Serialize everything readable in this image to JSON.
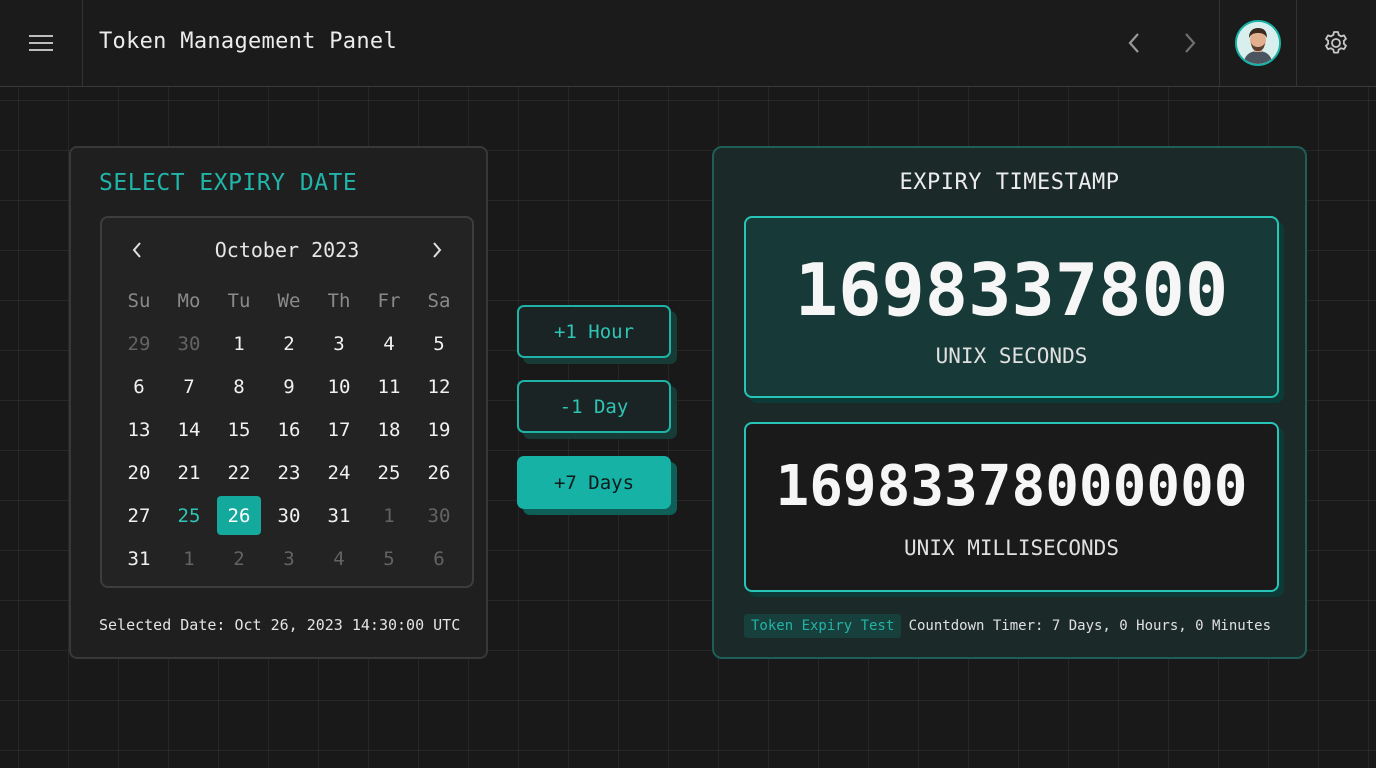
{
  "header": {
    "title": "Token Management Panel"
  },
  "icons": {
    "menu": "hamburger-menu-icon",
    "back": "chevron-left-icon",
    "forward": "chevron-right-icon",
    "settings": "gear-icon",
    "avatar": "user-avatar"
  },
  "colors": {
    "accent": "#1fb2a6",
    "background": "#191919",
    "panel": "#1f1f1f",
    "timestamp_panel": "#1b2a29"
  },
  "date_picker": {
    "title": "SELECT EXPIRY DATE",
    "month_label": "October 2023",
    "weekdays": [
      "Su",
      "Mo",
      "Tu",
      "We",
      "Th",
      "Fr",
      "Sa"
    ],
    "days": [
      {
        "label": "29",
        "other": true
      },
      {
        "label": "30",
        "other": true
      },
      {
        "label": "1"
      },
      {
        "label": "2"
      },
      {
        "label": "3"
      },
      {
        "label": "4"
      },
      {
        "label": "5"
      },
      {
        "label": "6"
      },
      {
        "label": "7"
      },
      {
        "label": "8"
      },
      {
        "label": "9"
      },
      {
        "label": "10"
      },
      {
        "label": "11"
      },
      {
        "label": "12"
      },
      {
        "label": "13"
      },
      {
        "label": "14"
      },
      {
        "label": "15"
      },
      {
        "label": "16"
      },
      {
        "label": "17"
      },
      {
        "label": "18"
      },
      {
        "label": "19"
      },
      {
        "label": "20"
      },
      {
        "label": "21"
      },
      {
        "label": "22"
      },
      {
        "label": "23"
      },
      {
        "label": "24"
      },
      {
        "label": "25"
      },
      {
        "label": "26"
      },
      {
        "label": "27"
      },
      {
        "label": "25",
        "accent": true
      },
      {
        "label": "26",
        "selected": true
      },
      {
        "label": "30"
      },
      {
        "label": "31"
      },
      {
        "label": "1",
        "other": true
      },
      {
        "label": "30",
        "other": true
      },
      {
        "label": "31"
      },
      {
        "label": "1",
        "other": true
      },
      {
        "label": "2",
        "other": true
      },
      {
        "label": "3",
        "other": true
      },
      {
        "label": "4",
        "other": true
      },
      {
        "label": "5",
        "other": true
      },
      {
        "label": "6",
        "other": true
      }
    ],
    "selected_text": "Selected Date: Oct 26, 2023 14:30:00 UTC"
  },
  "quick_actions": {
    "plus_hour": "+1 Hour",
    "minus_day": "-1 Day",
    "plus_week": "+7 Days"
  },
  "timestamp": {
    "title": "EXPIRY TIMESTAMP",
    "seconds_value": "1698337800",
    "seconds_label": "UNIX SECONDS",
    "ms_value": "16983378000000",
    "ms_label": "UNIX MILLISECONDS",
    "tag": "Token Expiry Test",
    "countdown": "Countdown Timer: 7 Days, 0 Hours, 0 Minutes"
  }
}
